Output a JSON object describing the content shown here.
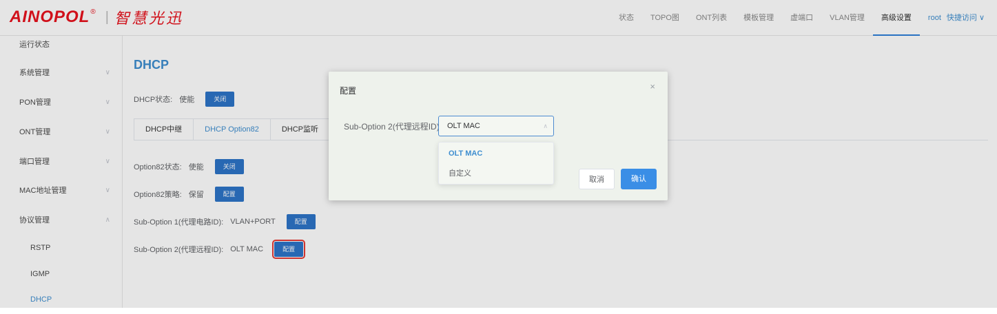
{
  "header": {
    "logo_text": "AINOPOL",
    "logo_reg": "®",
    "logo_sep": "|",
    "logo_cn": "智慧光迅",
    "nav": [
      {
        "label": "状态"
      },
      {
        "label": "TOPO图"
      },
      {
        "label": "ONT列表"
      },
      {
        "label": "模板管理"
      },
      {
        "label": "虚端口"
      },
      {
        "label": "VLAN管理"
      },
      {
        "label": "高级设置",
        "active": true
      }
    ],
    "user": "root",
    "quick_access": "快捷访问 ∨"
  },
  "sidebar": {
    "items": [
      {
        "label": "运行状态"
      },
      {
        "label": "系统管理",
        "chevron": "∨"
      },
      {
        "label": "PON管理",
        "chevron": "∨"
      },
      {
        "label": "ONT管理",
        "chevron": "∨"
      },
      {
        "label": "端口管理",
        "chevron": "∨"
      },
      {
        "label": "MAC地址管理",
        "chevron": "∨"
      },
      {
        "label": "协议管理",
        "chevron": "∧"
      }
    ],
    "subitems": [
      {
        "label": "RSTP"
      },
      {
        "label": "IGMP"
      },
      {
        "label": "DHCP",
        "active": true
      }
    ]
  },
  "main": {
    "title": "DHCP",
    "dhcp_status_label": "DHCP状态:",
    "dhcp_status_value": "使能",
    "dhcp_status_button": "关闭",
    "tabs": [
      {
        "label": "DHCP中继"
      },
      {
        "label": "DHCP Option82",
        "active": true
      },
      {
        "label": "DHCP监听"
      }
    ],
    "option82_status_label": "Option82状态:",
    "option82_status_value": "使能",
    "option82_status_button": "关闭",
    "option82_policy_label": "Option82策略:",
    "option82_policy_value": "保留",
    "option82_policy_button": "配置",
    "sub1_label": "Sub-Option 1(代理电路ID):",
    "sub1_value": "VLAN+PORT",
    "sub1_button": "配置",
    "sub2_label": "Sub-Option 2(代理远程ID):",
    "sub2_value": "OLT MAC",
    "sub2_button": "配置"
  },
  "dialog": {
    "title": "配置",
    "close": "×",
    "field_label": "Sub-Option 2(代理远程ID)",
    "select_value": "OLT MAC",
    "select_arrow": "∧",
    "options": [
      {
        "label": "OLT MAC",
        "selected": true
      },
      {
        "label": "自定义"
      }
    ],
    "cancel": "取消",
    "confirm": "确认"
  },
  "colors": {
    "brand_red": "#e8121d",
    "accent_blue": "#3e8ed0",
    "button_blue": "#2d74c8",
    "highlight_red": "#e53935"
  }
}
